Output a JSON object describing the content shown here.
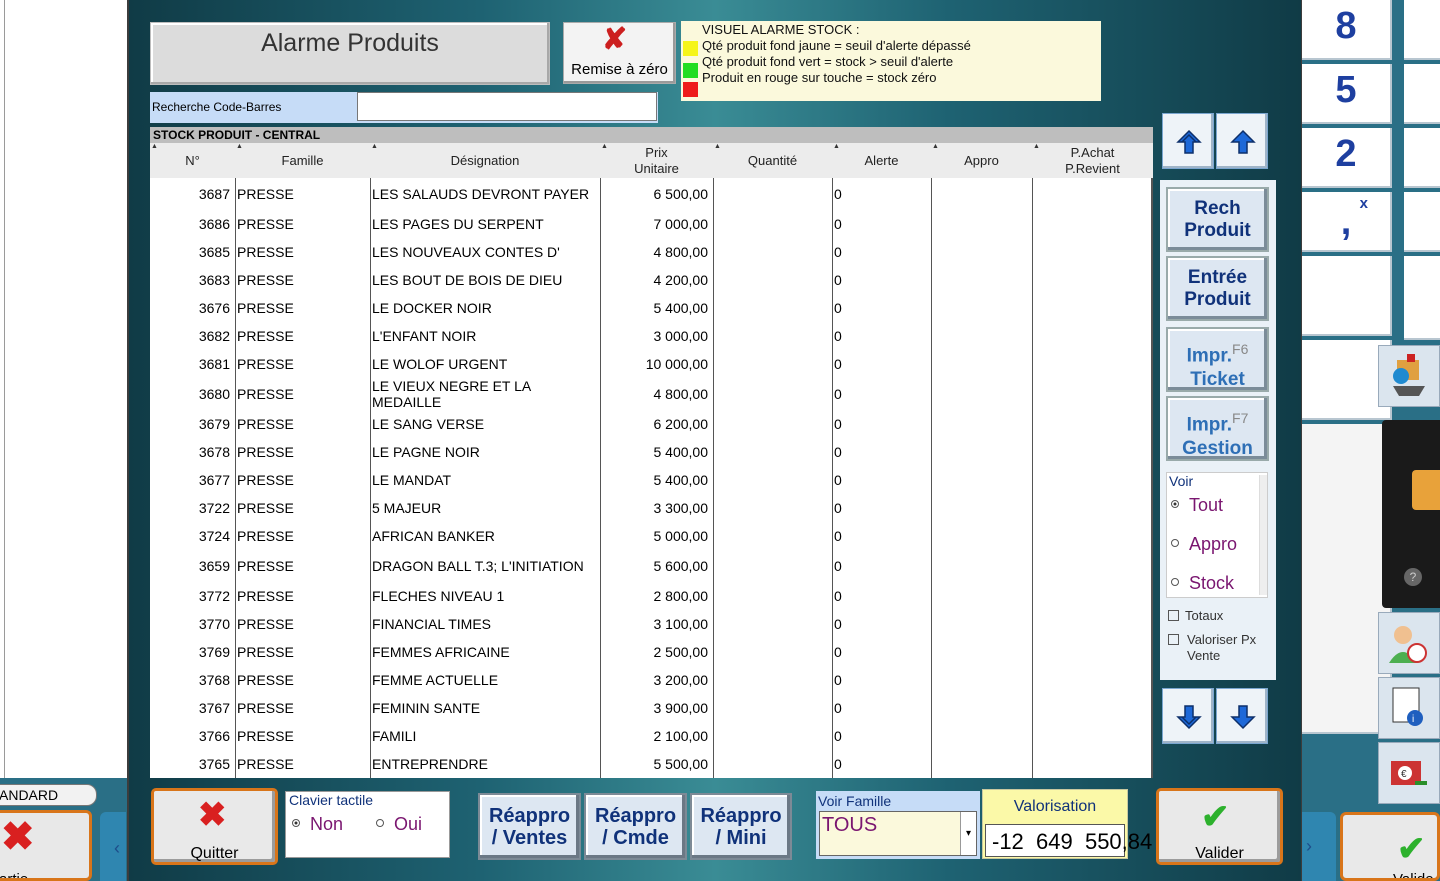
{
  "left_panel": {
    "mode_label": "ANDARD",
    "button_label": "artie"
  },
  "header": {
    "title": "Alarme Produits",
    "reset_label": "Remise à zéro"
  },
  "legend": {
    "title": "VISUEL ALARME STOCK :",
    "yellow": "Qté produit fond jaune = seuil d'alerte dépassé",
    "green": "Qté produit fond vert = stock > seuil d'alerte",
    "red": "Produit en rouge sur touche = stock zéro",
    "colors": {
      "yellow": "#f5f51a",
      "green": "#22dd22",
      "red": "#ee1c1c"
    }
  },
  "search": {
    "label": "Recherche Code-Barres",
    "value": ""
  },
  "grid": {
    "title": "STOCK PRODUIT - CENTRAL",
    "columns": [
      "N°",
      "Famille",
      "Désignation",
      "Prix\nUnitaire",
      "Quantité",
      "Alerte",
      "Appro",
      "P.Achat\nP.Revient"
    ],
    "rows": [
      [
        "3687",
        "PRESSE",
        "LES SALAUDS DEVRONT PAYER",
        "6 500,00",
        "",
        "0",
        "",
        ""
      ],
      [
        "3686",
        "PRESSE",
        "LES PAGES DU SERPENT",
        "7 000,00",
        "",
        "0",
        "",
        ""
      ],
      [
        "3685",
        "PRESSE",
        "LES NOUVEAUX CONTES D'",
        "4 800,00",
        "",
        "0",
        "",
        ""
      ],
      [
        "3683",
        "PRESSE",
        "LES BOUT DE BOIS DE DIEU",
        "4 200,00",
        "",
        "0",
        "",
        ""
      ],
      [
        "3676",
        "PRESSE",
        "LE DOCKER NOIR",
        "5 400,00",
        "",
        "0",
        "",
        ""
      ],
      [
        "3682",
        "PRESSE",
        "L'ENFANT NOIR",
        "3 000,00",
        "",
        "0",
        "",
        ""
      ],
      [
        "3681",
        "PRESSE",
        "LE WOLOF URGENT",
        "10 000,00",
        "",
        "0",
        "",
        ""
      ],
      [
        "3680",
        "PRESSE",
        "LE VIEUX NEGRE ET LA MEDAILLE",
        "4 800,00",
        "",
        "0",
        "",
        ""
      ],
      [
        "3679",
        "PRESSE",
        "LE SANG VERSE",
        "6 200,00",
        "",
        "0",
        "",
        ""
      ],
      [
        "3678",
        "PRESSE",
        "LE PAGNE NOIR",
        "5 400,00",
        "",
        "0",
        "",
        ""
      ],
      [
        "3677",
        "PRESSE",
        "LE MANDAT",
        "5 400,00",
        "",
        "0",
        "",
        ""
      ],
      [
        "3722",
        "PRESSE",
        "5 MAJEUR",
        "3 300,00",
        "",
        "0",
        "",
        ""
      ],
      [
        "3724",
        "PRESSE",
        "AFRICAN BANKER",
        "5 000,00",
        "",
        "0",
        "",
        ""
      ],
      [
        "3659",
        "PRESSE",
        "DRAGON BALL T.3; L'INITIATION",
        "5 600,00",
        "",
        "0",
        "",
        ""
      ],
      [
        "3772",
        "PRESSE",
        "FLECHES NIVEAU 1",
        "2 800,00",
        "",
        "0",
        "",
        ""
      ],
      [
        "3770",
        "PRESSE",
        "FINANCIAL TIMES",
        "3 100,00",
        "",
        "0",
        "",
        ""
      ],
      [
        "3769",
        "PRESSE",
        "FEMMES AFRICAINE",
        "2 500,00",
        "",
        "0",
        "",
        ""
      ],
      [
        "3768",
        "PRESSE",
        "FEMME ACTUELLE",
        "3 200,00",
        "",
        "0",
        "",
        ""
      ],
      [
        "3767",
        "PRESSE",
        "FEMININ SANTE",
        "3 900,00",
        "",
        "0",
        "",
        ""
      ],
      [
        "3766",
        "PRESSE",
        "FAMILI",
        "2 100,00",
        "",
        "0",
        "",
        ""
      ],
      [
        "3765",
        "PRESSE",
        "ENTREPRENDRE",
        "5 500,00",
        "",
        "0",
        "",
        ""
      ]
    ]
  },
  "side": {
    "rech_produit": [
      "Rech",
      "Produit"
    ],
    "entree_produit": [
      "Entrée",
      "Produit"
    ],
    "impr_ticket": {
      "line1": "Impr.",
      "key": "F6",
      "line2": "Ticket"
    },
    "impr_gestion": {
      "line1": "Impr.",
      "key": "F7",
      "line2": "Gestion"
    },
    "voir": {
      "title": "Voir",
      "options": [
        "Tout",
        "Appro",
        "Stock"
      ],
      "selected": "Tout"
    },
    "totaux": "Totaux",
    "valoriser": [
      "Valoriser Px",
      "Vente"
    ]
  },
  "numpad": {
    "keys": [
      "8",
      "5",
      "2",
      ","
    ],
    "mult": "x"
  },
  "bottom": {
    "quit_label": "Quitter",
    "clavier": {
      "title": "Clavier tactile",
      "non": "Non",
      "oui": "Oui",
      "selected": "Non"
    },
    "reappro_ventes": [
      "Réappro",
      "/ Ventes"
    ],
    "reappro_cmde": [
      "Réappro",
      "/ Cmde"
    ],
    "reappro_mini": [
      "Réappro",
      "/ Mini"
    ],
    "voir_famille": {
      "label": "Voir Famille",
      "value": "TOUS"
    },
    "valorisation": {
      "label": "Valorisation",
      "value": "-12  649  550,84"
    },
    "valider_label": "Valider",
    "right_valider_label": "Valide"
  }
}
